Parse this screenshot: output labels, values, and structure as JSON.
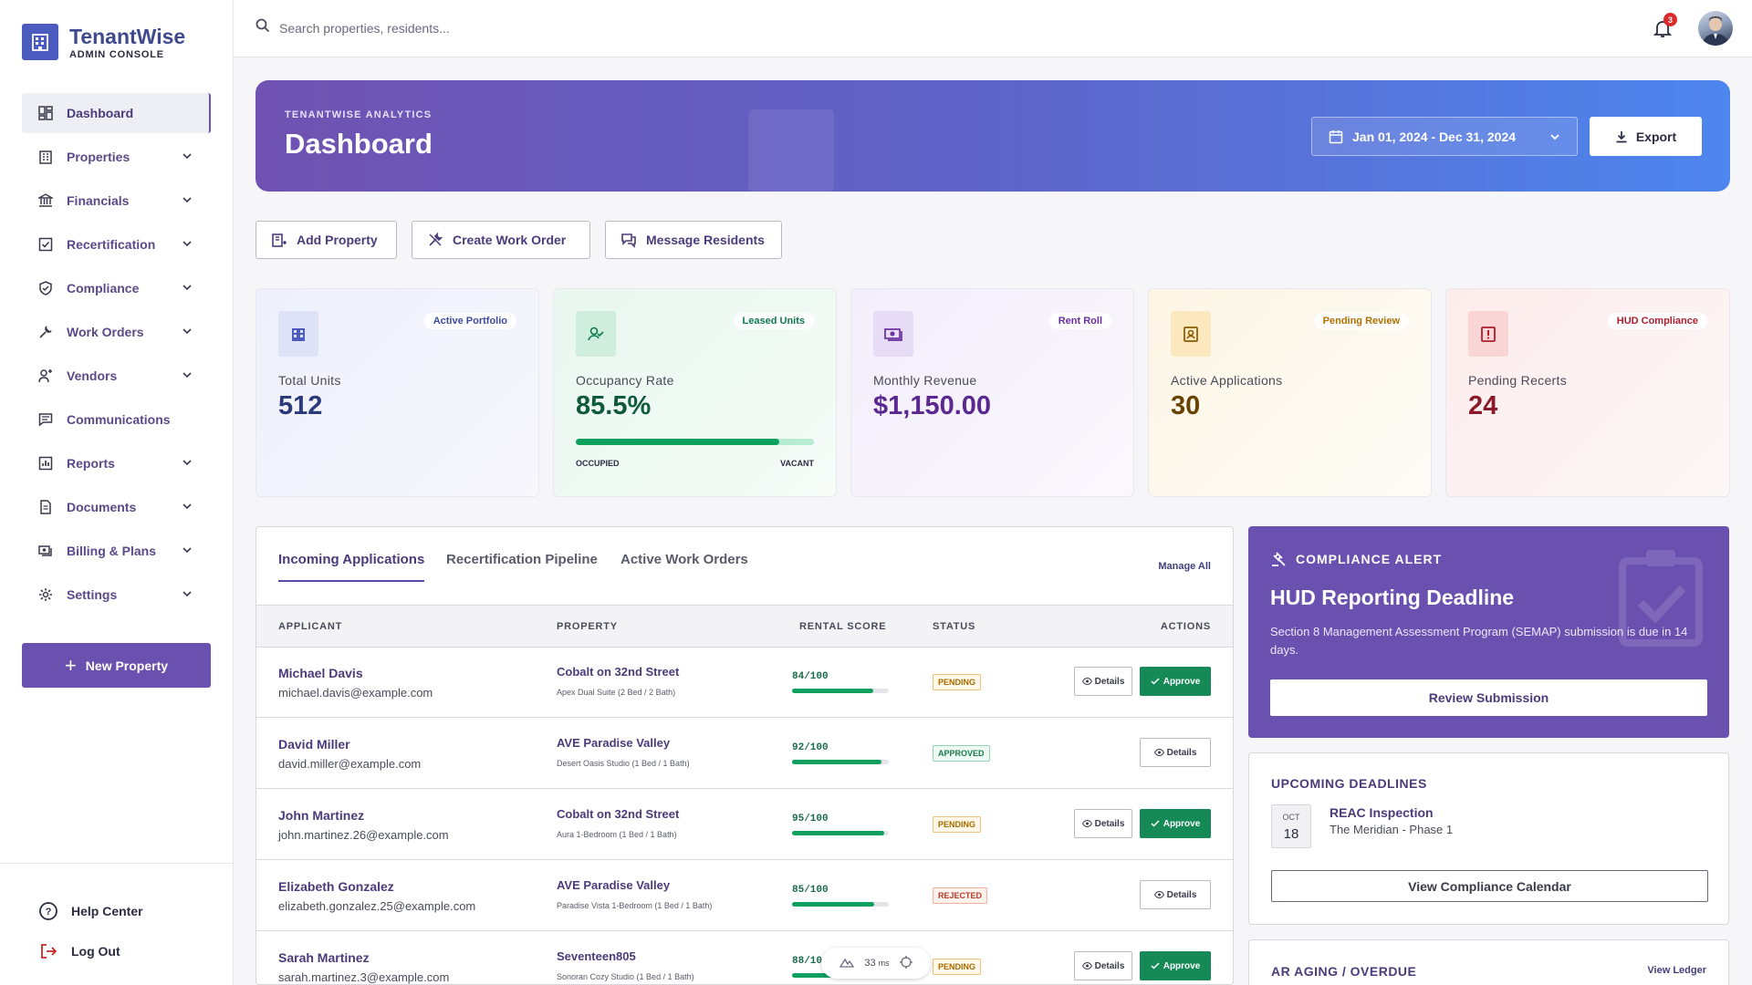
{
  "brand": {
    "name": "TenantWise",
    "subtitle": "ADMIN CONSOLE"
  },
  "nav": [
    {
      "label": "Dashboard",
      "icon": "dashboard-icon",
      "active": true,
      "chevron": false
    },
    {
      "label": "Properties",
      "icon": "building-icon",
      "chevron": true
    },
    {
      "label": "Financials",
      "icon": "bank-icon",
      "chevron": true
    },
    {
      "label": "Recertification",
      "icon": "checkbox-icon",
      "chevron": true
    },
    {
      "label": "Compliance",
      "icon": "shield-icon",
      "chevron": true
    },
    {
      "label": "Work Orders",
      "icon": "wrench-icon",
      "chevron": true
    },
    {
      "label": "Vendors",
      "icon": "vendor-icon",
      "chevron": true
    },
    {
      "label": "Communications",
      "icon": "chat-icon",
      "chevron": false
    },
    {
      "label": "Reports",
      "icon": "report-icon",
      "chevron": true
    },
    {
      "label": "Documents",
      "icon": "document-icon",
      "chevron": true
    },
    {
      "label": "Billing & Plans",
      "icon": "billing-icon",
      "chevron": true
    },
    {
      "label": "Settings",
      "icon": "gear-icon",
      "chevron": true
    }
  ],
  "new_property": "New Property",
  "help": "Help Center",
  "logout": "Log Out",
  "search": {
    "placeholder": "Search properties, residents..."
  },
  "notifications": {
    "count": "3"
  },
  "hero": {
    "eyebrow": "TENANTWISE ANALYTICS",
    "title": "Dashboard",
    "date_range": "Jan 01, 2024 - Dec 31, 2024",
    "export": "Export"
  },
  "quick_actions": [
    "Add Property",
    "Create Work Order",
    "Message Residents"
  ],
  "stats": [
    {
      "label": "Total Units",
      "value": "512",
      "pill": "Active Portfolio"
    },
    {
      "label": "Occupancy Rate",
      "value": "85.5%",
      "pill": "Leased Units",
      "occupied_pct": 85.5,
      "occupied": "OCCUPIED",
      "vacant": "VACANT"
    },
    {
      "label": "Monthly Revenue",
      "value": "$1,150.00",
      "pill": "Rent Roll"
    },
    {
      "label": "Active Applications",
      "value": "30",
      "pill": "Pending Review"
    },
    {
      "label": "Pending Recerts",
      "value": "24",
      "pill": "HUD Compliance"
    }
  ],
  "tabs": [
    "Incoming Applications",
    "Recertification Pipeline",
    "Active Work Orders"
  ],
  "manage_all": "Manage All",
  "columns": [
    "APPLICANT",
    "PROPERTY",
    "RENTAL SCORE",
    "STATUS",
    "ACTIONS"
  ],
  "rows": [
    {
      "name": "Michael Davis",
      "email": "michael.davis@example.com",
      "property": "Cobalt on 32nd Street",
      "unit": "Apex Dual Suite (2 Bed / 2 Bath)",
      "score": "84/100",
      "score_pct": 84,
      "status": "PENDING",
      "status_class": "pending",
      "approve": true
    },
    {
      "name": "David Miller",
      "email": "david.miller@example.com",
      "property": "AVE Paradise Valley",
      "unit": "Desert Oasis Studio (1 Bed / 1 Bath)",
      "score": "92/100",
      "score_pct": 92,
      "status": "APPROVED",
      "status_class": "approved",
      "approve": false
    },
    {
      "name": "John Martinez",
      "email": "john.martinez.26@example.com",
      "property": "Cobalt on 32nd Street",
      "unit": "Aura 1-Bedroom (1 Bed / 1 Bath)",
      "score": "95/100",
      "score_pct": 95,
      "status": "PENDING",
      "status_class": "pending",
      "approve": true
    },
    {
      "name": "Elizabeth Gonzalez",
      "email": "elizabeth.gonzalez.25@example.com",
      "property": "AVE Paradise Valley",
      "unit": "Paradise Vista 1-Bedroom (1 Bed / 1 Bath)",
      "score": "85/100",
      "score_pct": 85,
      "status": "REJECTED",
      "status_class": "rejected",
      "approve": false
    },
    {
      "name": "Sarah Martinez",
      "email": "sarah.martinez.3@example.com",
      "property": "Seventeen805",
      "unit": "Sonoran Cozy Studio (1 Bed / 1 Bath)",
      "score": "88/100",
      "score_pct": 88,
      "status": "PENDING",
      "status_class": "pending",
      "approve": true
    }
  ],
  "action_labels": {
    "details": "Details",
    "approve": "Approve"
  },
  "perf": {
    "value": "33",
    "unit": "ms"
  },
  "alert": {
    "eyebrow": "COMPLIANCE ALERT",
    "title": "HUD Reporting Deadline",
    "text": "Section 8 Management Assessment Program (SEMAP) submission is due in 14 days.",
    "button": "Review Submission"
  },
  "deadlines": {
    "title": "UPCOMING DEADLINES",
    "items": [
      {
        "month": "OCT",
        "day": "18",
        "name": "REAC Inspection",
        "sub": "The Meridian - Phase 1"
      }
    ],
    "button": "View Compliance Calendar"
  },
  "aging": {
    "title": "AR AGING / OVERDUE",
    "link": "View Ledger"
  },
  "colors": {
    "accent": "#6a51b0",
    "brand": "#4b5bbf",
    "success": "#158a56"
  }
}
